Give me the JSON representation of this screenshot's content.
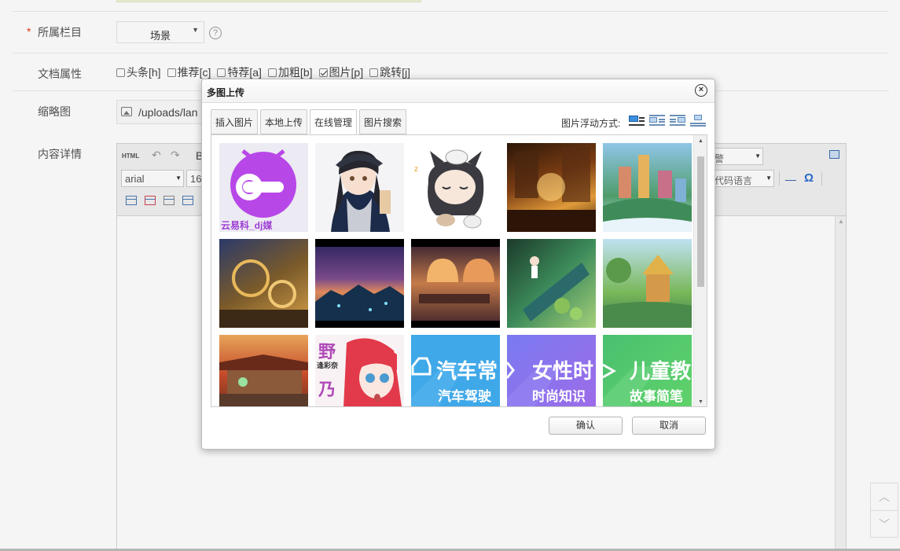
{
  "form": {
    "category_label": "所属栏目",
    "category_required": "*",
    "category_value": "场景",
    "help_icon": "question-circle-icon",
    "attrs_label": "文档属性",
    "attrs": [
      {
        "label": "头条[h]",
        "checked": false
      },
      {
        "label": "推荐[c]",
        "checked": false
      },
      {
        "label": "特荐[a]",
        "checked": false
      },
      {
        "label": "加粗[b]",
        "checked": false
      },
      {
        "label": "图片[p]",
        "checked": true
      },
      {
        "label": "跳转[j]",
        "checked": false
      }
    ],
    "thumb_label": "缩略图",
    "thumb_value": "/uploads/lan",
    "content_label": "内容详情"
  },
  "editor": {
    "html_label": "HTML",
    "bold_label": "B",
    "font_value": "arial",
    "size_value": "16",
    "select_partial": "警",
    "code_lang": "代码语言",
    "hr_glyph": "—",
    "special_char": "Ω"
  },
  "dialog": {
    "title": "多图上传",
    "close_glyph": "×",
    "tabs": [
      {
        "label": "插入图片",
        "active": false
      },
      {
        "label": "本地上传",
        "active": false
      },
      {
        "label": "在线管理",
        "active": true
      },
      {
        "label": "图片搜索",
        "active": false
      }
    ],
    "float_label": "图片浮动方式:",
    "align_options": [
      "none",
      "left",
      "right",
      "center"
    ],
    "confirm_label": "确认",
    "cancel_label": "取消"
  },
  "images": {
    "logo_text": "云易科_dj媒",
    "car_title": "汽车常",
    "car_sub": "汽车驾驶",
    "female_title": "女性时",
    "female_sub": "时尚知识",
    "kids_title": "儿童教",
    "kids_sub": "故事简笔",
    "anime_text": "野",
    "anime_text2": "乃",
    "anime_badge": "逢彩奈"
  },
  "colors": {
    "accent": "#3d8ee0",
    "required": "#e0401a",
    "logo_purple": "#b847e8",
    "car_blue": "#3fa8e8",
    "female_purple": "#8a72ec",
    "kids_green": "#52c96a"
  }
}
